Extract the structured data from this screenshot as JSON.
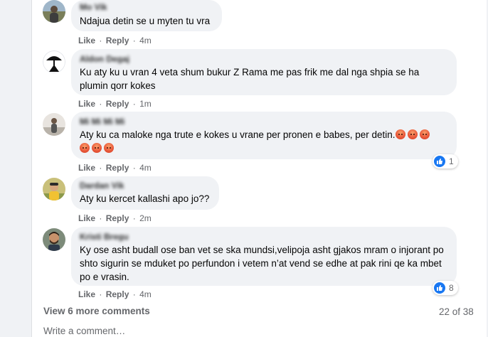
{
  "comments": [
    {
      "author": "Mo Vik",
      "text": "Ndajua detin se u myten tu vra",
      "like": "Like",
      "reply": "Reply",
      "time": "4m"
    },
    {
      "author": "Aldon Degaj",
      "text": "Ku aty ku u vran 4 veta shum bukur Z Rama me pas frik me dal nga shpia se ha plumin qorr kokes",
      "like": "Like",
      "reply": "Reply",
      "time": "1m"
    },
    {
      "author": "Mi Mi Mi Mi",
      "text": "Aty ku ca maloke nga trute e kokes u vrane per pronen e babes, per detin.",
      "like": "Like",
      "reply": "Reply",
      "time": "4m",
      "reaction_count": "1"
    },
    {
      "author": "Dardan Vik",
      "text": "Aty ku kercet kallashi apo jo??",
      "like": "Like",
      "reply": "Reply",
      "time": "2m"
    },
    {
      "author": "Kristi Bregu",
      "text": "Ky ose asht budall ose ban vet se ska mundsi,velipoja asht gjakos mram o injorant po shto sigurin se mduket po perfundon i vetem n’at vend se edhe at pak rini qe ka mbet po e vrasin.",
      "like": "Like",
      "reply": "Reply",
      "time": "4m",
      "reaction_count": "8"
    }
  ],
  "separator": "·",
  "view_more": "View 6 more comments",
  "page_count": "22 of 38",
  "write_placeholder": "Write a comment…",
  "colors": {
    "bubble": "#f0f2f5",
    "meta": "#65676b",
    "like_blue": "#1877f2",
    "angry_emoji": "#ea5a3b"
  },
  "icons": [
    "like-reaction-icon",
    "angry-emoji-icon"
  ]
}
